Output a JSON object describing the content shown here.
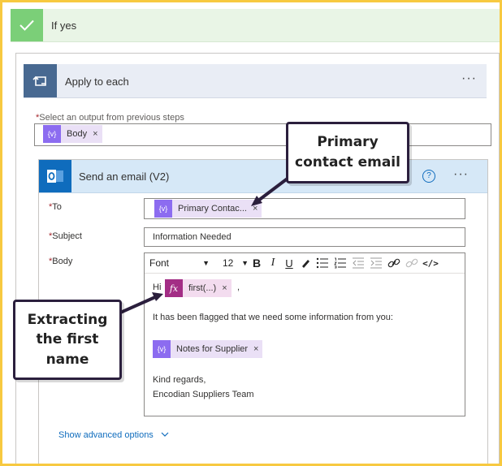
{
  "if_yes": {
    "label": "If yes"
  },
  "apply_each": {
    "title": "Apply to each",
    "more": "···"
  },
  "select_output": {
    "required_mark": "*",
    "label": "Select an output from previous steps",
    "token": {
      "icon": "{v}",
      "label": "Body",
      "remove": "×"
    }
  },
  "email": {
    "title": "Send an email (V2)",
    "help": "?",
    "more": "···",
    "to_label": "To",
    "to_token": {
      "icon": "{v}",
      "label": "Primary Contac...",
      "remove": "×"
    },
    "subject_label": "Subject",
    "subject_value": "Information Needed",
    "body_label": "Body",
    "toolbar": {
      "font": "Font",
      "size": "12",
      "bold": "B",
      "italic": "I",
      "underline": "U",
      "code": "</>"
    },
    "body": {
      "greeting": "Hi",
      "fx_token": {
        "icon": "fx",
        "label": "first(...)",
        "remove": "×"
      },
      "trailing_comma": ",",
      "line1": "It has been flagged that we need some information from you:",
      "notes_token": {
        "icon": "{v}",
        "label": "Notes for Supplier",
        "remove": "×"
      },
      "signoff1": "Kind regards,",
      "signoff2": "Encodian Suppliers Team"
    },
    "advanced": "Show advanced options"
  },
  "callouts": {
    "primary_line1": "Primary",
    "primary_line2": "contact email",
    "extract_line1": "Extracting",
    "extract_line2": "the first",
    "extract_line3": "name"
  },
  "colors": {
    "border": "#f7c940",
    "if_yes_check": "#7bcf78",
    "apply_icon": "#486991",
    "outlook": "#0f6cbd",
    "token_variable": "#8c6cf0",
    "token_expression": "#a32d85"
  }
}
